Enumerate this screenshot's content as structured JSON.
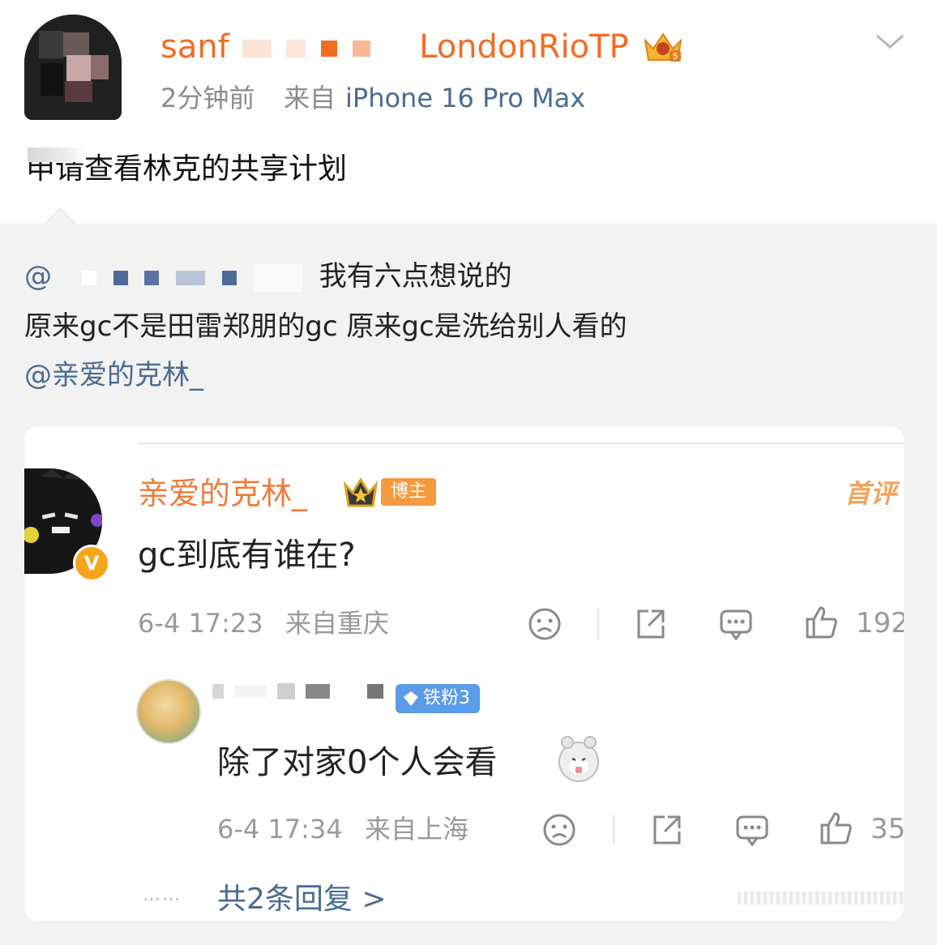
{
  "post": {
    "username_start": "sanf",
    "username_end": "LondonRioTP",
    "time": "2分钟前",
    "source_label": "来自",
    "device": "iPhone 16 Pro Max",
    "text": "申请查看林克的共享计划"
  },
  "repost": {
    "line1_prefix": "@",
    "line1_text": "我有六点想说的",
    "line2": "原来gc不是田雷郑朋的gc 原来gc是洗给别人看的",
    "mention": "@亲爱的克林_"
  },
  "comment_card": {
    "comments": [
      {
        "name": "亲爱的克林_",
        "tag": "博主",
        "first_comment_label": "首评",
        "verified_mark": "V",
        "text": "gc到底有谁在?",
        "time": "6-4 17:23",
        "source": "来自重庆",
        "likes": "192"
      },
      {
        "badge": "铁粉3",
        "text": "除了对家0个人会看",
        "time": "6-4 17:34",
        "source": "来自上海",
        "likes": "35"
      }
    ],
    "more_dots": "……",
    "more_replies": "共2条回复 >"
  },
  "icons": {
    "vip": "vip-crown-icon",
    "collapse": "chevron-down-icon",
    "dislike": "sad-face-icon",
    "share": "share-icon",
    "reply": "comment-icon",
    "like": "thumbs-up-icon"
  },
  "colors": {
    "username": "#f36c22",
    "link": "#4a6b93",
    "comment_name": "#f07c3a",
    "blogger_tag": "#f59a3e",
    "fan_badge": "#5b9be8",
    "repost_bg": "#f2f2f2"
  }
}
